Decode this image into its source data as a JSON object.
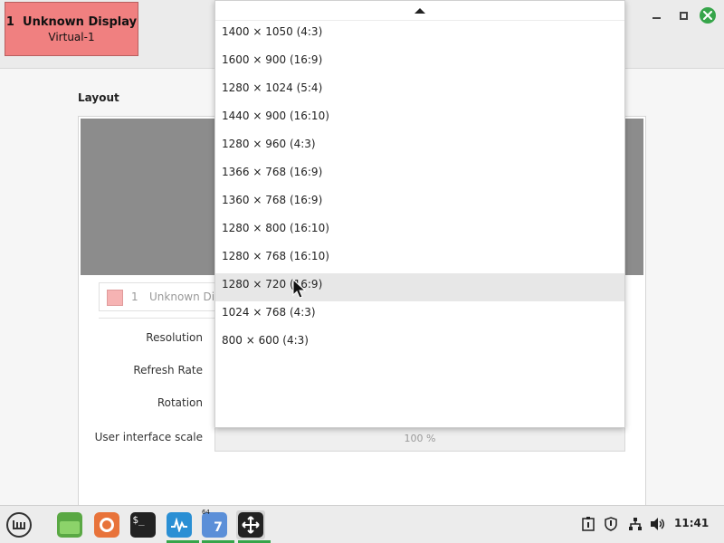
{
  "window": {
    "display_badge": {
      "number": "1",
      "name": "Unknown Display",
      "connector": "Virtual-1"
    },
    "controls": {
      "minimize": "minimize-icon",
      "maximize": "maximize-icon",
      "close": "close-icon"
    }
  },
  "layout": {
    "title": "Layout",
    "display_row": {
      "number": "1",
      "name": "Unknown Display"
    }
  },
  "settings": {
    "resolution_label": "Resolution",
    "refresh_label": "Refresh Rate",
    "rotation_label": "Rotation",
    "scale_label": "User interface scale",
    "scale_value": "100 %"
  },
  "dropdown": {
    "items": [
      "1400 × 1050 (4:3)",
      "1600 × 900 (16:9)",
      "1280 × 1024 (5:4)",
      "1440 × 900 (16:10)",
      "1280 × 960 (4:3)",
      "1366 × 768 (16:9)",
      "1360 × 768 (16:9)",
      "1280 × 800 (16:10)",
      "1280 × 768 (16:10)",
      "1280 × 720 (16:9)",
      "1024 × 768 (4:3)",
      "800 × 600 (4:3)"
    ],
    "hovered_index": 9
  },
  "taskbar": {
    "items": [
      {
        "name": "menu-icon"
      },
      {
        "name": "files-icon"
      },
      {
        "name": "firefox-icon"
      },
      {
        "name": "terminal-icon"
      },
      {
        "name": "system-monitor-icon"
      },
      {
        "name": "wine-icon",
        "badge": "64"
      },
      {
        "name": "display-settings-icon"
      }
    ],
    "tray": [
      "clipboard-icon",
      "shield-icon",
      "network-icon",
      "volume-icon"
    ],
    "clock": "11:41"
  },
  "colors": {
    "display_badge": "#f08080",
    "accent_green": "#36a54a",
    "hover_row": "#e7e7e7"
  }
}
